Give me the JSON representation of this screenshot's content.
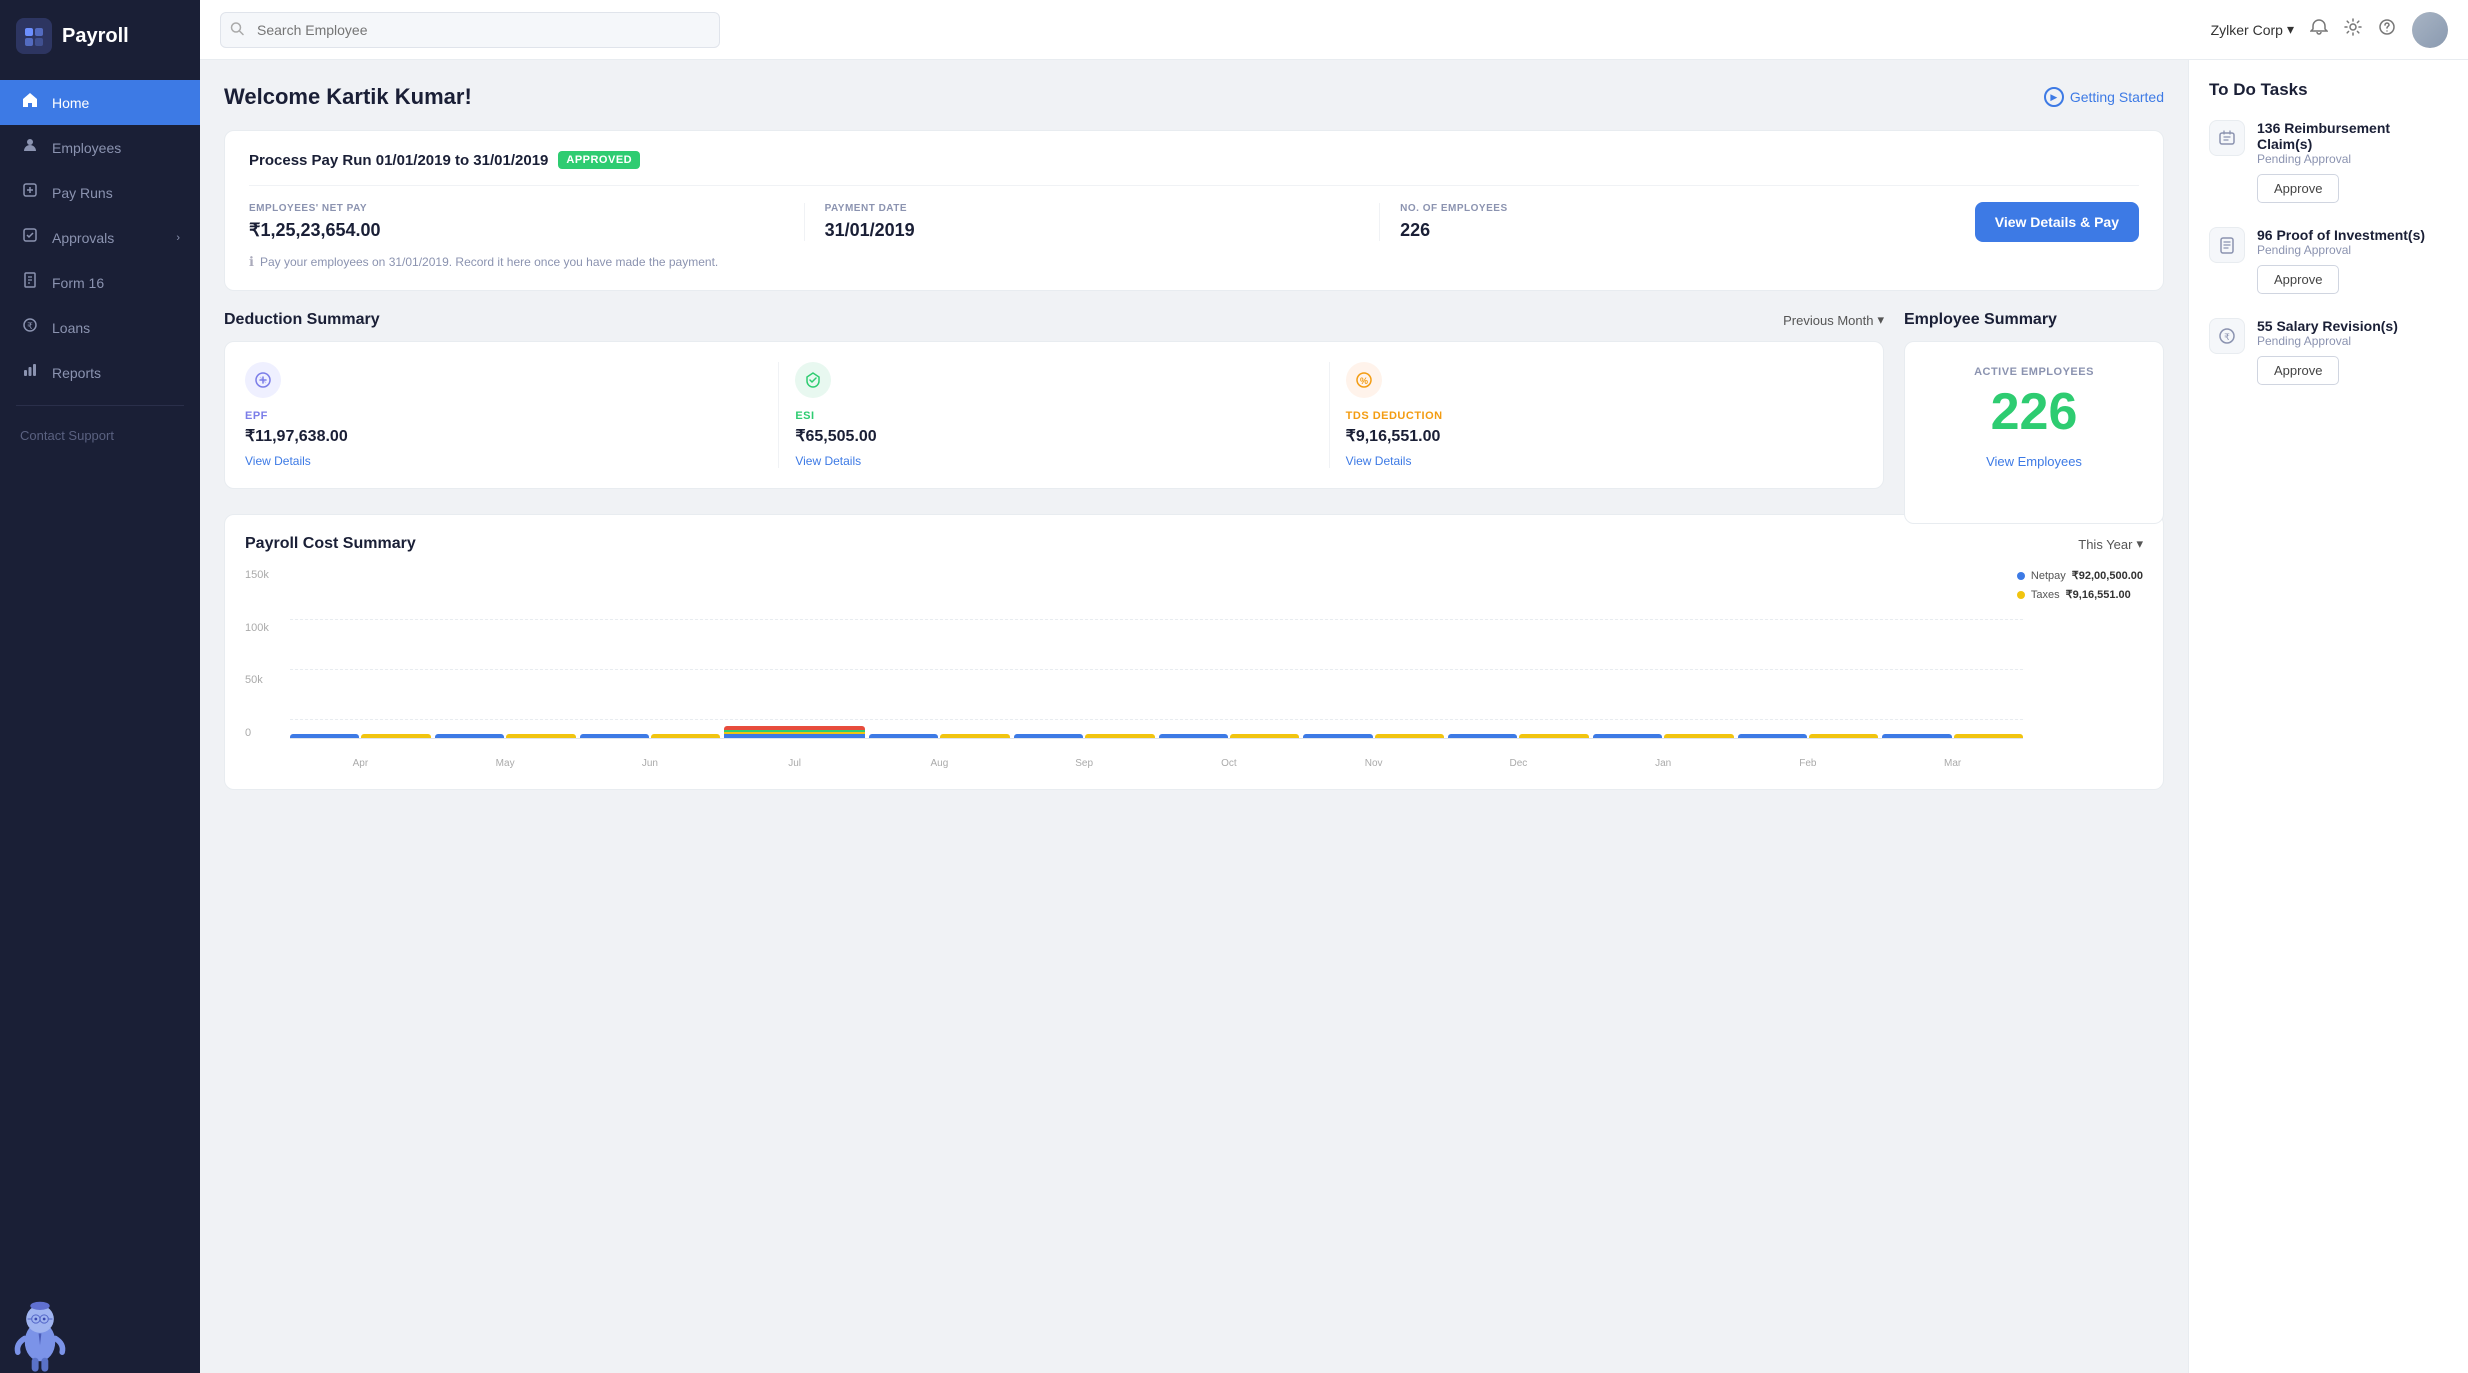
{
  "app": {
    "name": "Payroll",
    "logo_icon": "₹"
  },
  "sidebar": {
    "nav_items": [
      {
        "id": "home",
        "label": "Home",
        "icon": "⌂",
        "active": true
      },
      {
        "id": "employees",
        "label": "Employees",
        "icon": "👤"
      },
      {
        "id": "pay_runs",
        "label": "Pay Runs",
        "icon": "↗"
      },
      {
        "id": "approvals",
        "label": "Approvals",
        "icon": "✓",
        "has_arrow": true
      },
      {
        "id": "form16",
        "label": "Form 16",
        "icon": "▦"
      },
      {
        "id": "loans",
        "label": "Loans",
        "icon": "₹"
      },
      {
        "id": "reports",
        "label": "Reports",
        "icon": "▤"
      }
    ],
    "contact_support": "Contact Support"
  },
  "topbar": {
    "search_placeholder": "Search Employee",
    "company": "Zylker Corp",
    "getting_started": "Getting Started"
  },
  "main": {
    "welcome_title": "Welcome Kartik Kumar!",
    "pay_run": {
      "label": "Process Pay Run",
      "date_range": "01/01/2019 to 31/01/2019",
      "status": "APPROVED",
      "employees_net_pay_label": "EMPLOYEES' NET PAY",
      "employees_net_pay": "₹1,25,23,654.00",
      "payment_date_label": "PAYMENT DATE",
      "payment_date": "31/01/2019",
      "no_of_employees_label": "NO. OF EMPLOYEES",
      "no_of_employees": "226",
      "view_button": "View Details & Pay",
      "info_text": "Pay your employees on 31/01/2019. Record it here once you have made the payment."
    },
    "deduction_summary": {
      "title": "Deduction Summary",
      "period": "Previous Month",
      "items": [
        {
          "id": "epf",
          "label": "EPF",
          "value": "₹11,97,638.00",
          "link": "View Details"
        },
        {
          "id": "esi",
          "label": "ESI",
          "value": "₹65,505.00",
          "link": "View Details"
        },
        {
          "id": "tds",
          "label": "TDS DEDUCTION",
          "value": "₹9,16,551.00",
          "link": "View Details"
        }
      ]
    },
    "employee_summary": {
      "title": "Employee Summary",
      "active_label": "ACTIVE EMPLOYEES",
      "active_count": "226",
      "view_link": "View Employees"
    },
    "payroll_cost": {
      "title": "Payroll Cost Summary",
      "period": "This Year",
      "legend": [
        {
          "label": "Netpay",
          "color": "#3d7ae5",
          "value": "₹92,00,500.00"
        },
        {
          "label": "Taxes",
          "color": "#f1c40f",
          "value": "₹9,16,551.00"
        }
      ],
      "y_labels": [
        "150k",
        "100k",
        "50k",
        "0"
      ],
      "x_labels": [
        "Apr",
        "May",
        "Jun",
        "Jul",
        "Aug",
        "Sep",
        "Oct",
        "Nov",
        "Dec",
        "Jan",
        "Feb",
        "Mar"
      ],
      "bars": [
        {
          "netpay": 75,
          "taxes": 8
        },
        {
          "netpay": 82,
          "taxes": 9
        },
        {
          "netpay": 45,
          "taxes": 20
        },
        {
          "netpay": 48,
          "taxes": 22
        },
        {
          "netpay": 60,
          "taxes": 7
        },
        {
          "netpay": 55,
          "taxes": 6
        },
        {
          "netpay": 70,
          "taxes": 8
        },
        {
          "netpay": 78,
          "taxes": 9
        },
        {
          "netpay": 65,
          "taxes": 7
        },
        {
          "netpay": 80,
          "taxes": 10
        },
        {
          "netpay": 72,
          "taxes": 8
        },
        {
          "netpay": 85,
          "taxes": 9
        }
      ]
    }
  },
  "todo": {
    "title": "To Do Tasks",
    "items": [
      {
        "id": "reimbursement",
        "count": "136",
        "label": "Reimbursement Claim(s)",
        "sub": "Pending Approval",
        "icon": "₹",
        "btn": "Approve"
      },
      {
        "id": "investment",
        "count": "96",
        "label": "Proof of Investment(s)",
        "sub": "Pending Approval",
        "icon": "📋",
        "btn": "Approve"
      },
      {
        "id": "salary",
        "count": "55",
        "label": "Salary Revision(s)",
        "sub": "Pending Approval",
        "icon": "🪙",
        "btn": "Approve"
      }
    ]
  }
}
